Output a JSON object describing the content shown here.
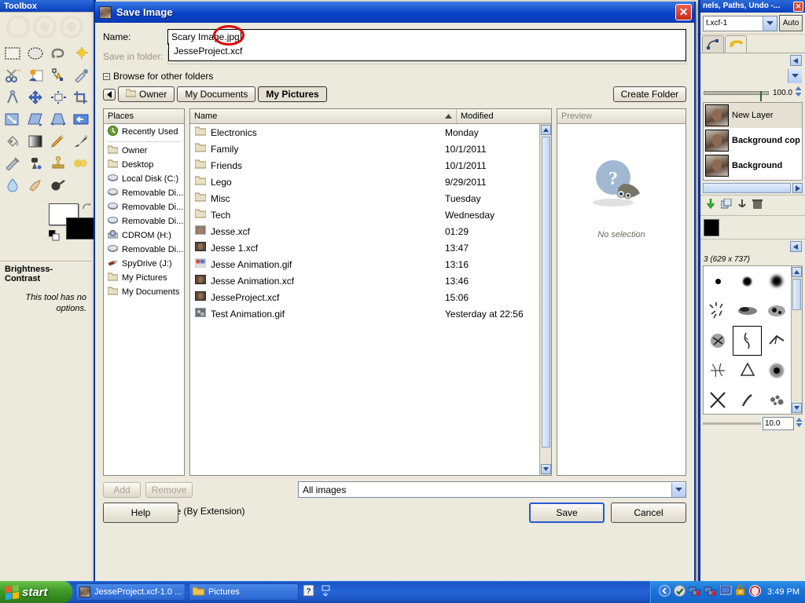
{
  "toolbox": {
    "title": "Toolbox",
    "tools": [
      "rect-select-tool",
      "ellipse-select-tool",
      "free-select-tool",
      "fuzzy-select-tool",
      "scissors-select-tool",
      "foreground-select-tool",
      "paths-tool",
      "color-picker-tool",
      "measure-tool",
      "move-tool",
      "alignment-tool",
      "crop-tool",
      "rotate-tool",
      "shear-tool",
      "perspective-tool",
      "flip-tool",
      "bucket-fill-tool",
      "gradient-tool",
      "pencil-tool",
      "paintbrush-tool",
      "airbrush-tool",
      "ink-tool",
      "clone-tool",
      "blur-sharpen-tool",
      "smudge-tool",
      "dodge-burn-tool",
      "eraser-tool"
    ],
    "active_tool_name": "Brightness-Contrast",
    "tool_note": "This tool has no options.",
    "foreground_color": "#ffffff",
    "background_color": "#000000"
  },
  "dock": {
    "title": "nels, Paths, Undo -...",
    "image_combo_value": "t.xcf-1",
    "auto_label": "Auto",
    "opacity_value": "100.0",
    "layers": [
      {
        "name": "New Layer",
        "selected": true,
        "bold": false
      },
      {
        "name": "Background copy",
        "selected": false,
        "bold": true
      },
      {
        "name": "Background",
        "selected": false,
        "bold": true
      }
    ],
    "brush_header": "3 (629 x 737)",
    "brush_size": "10.0"
  },
  "dialog": {
    "title": "Save Image",
    "name_label": "Name:",
    "name_value": "Scary Image.jpg",
    "autocomplete_suggestion": "JesseProject.xcf",
    "folder_label": "Save in folder:",
    "folder_value": "My Pictures",
    "browse_label": "Browse for other folders",
    "breadcrumb": [
      {
        "label": "Owner",
        "icon": "folder-icon",
        "active": false
      },
      {
        "label": "My Documents",
        "icon": "",
        "active": false
      },
      {
        "label": "My Pictures",
        "icon": "",
        "active": true
      }
    ],
    "create_folder_label": "Create Folder",
    "places_header": "Places",
    "places": [
      {
        "label": "Recently Used",
        "icon": "recent-icon"
      },
      {
        "label": "Owner",
        "icon": "folder-icon"
      },
      {
        "label": "Desktop",
        "icon": "folder-icon"
      },
      {
        "label": "Local Disk (C:)",
        "icon": "drive-icon"
      },
      {
        "label": "Removable Di...",
        "icon": "drive-icon"
      },
      {
        "label": "Removable Di...",
        "icon": "drive-icon"
      },
      {
        "label": "Removable Di...",
        "icon": "drive-icon"
      },
      {
        "label": "CDROM (H:)",
        "icon": "cdrom-icon"
      },
      {
        "label": "Removable Di...",
        "icon": "drive-icon"
      },
      {
        "label": "SpyDrive (J:)",
        "icon": "usb-icon"
      },
      {
        "label": "My Pictures",
        "icon": "folder-icon"
      },
      {
        "label": "My Documents",
        "icon": "folder-icon"
      }
    ],
    "columns": {
      "name": "Name",
      "modified": "Modified",
      "sort": "ascending"
    },
    "files": [
      {
        "name": "Electronics",
        "modified": "Monday",
        "type": "folder"
      },
      {
        "name": "Family",
        "modified": "10/1/2011",
        "type": "folder"
      },
      {
        "name": "Friends",
        "modified": "10/1/2011",
        "type": "folder"
      },
      {
        "name": "Lego",
        "modified": "9/29/2011",
        "type": "folder"
      },
      {
        "name": "Misc",
        "modified": "Tuesday",
        "type": "folder"
      },
      {
        "name": "Tech",
        "modified": "Wednesday",
        "type": "folder"
      },
      {
        "name": "Jesse.xcf",
        "modified": "01:29",
        "type": "photo"
      },
      {
        "name": "Jesse 1.xcf",
        "modified": "13:47",
        "type": "photo"
      },
      {
        "name": "Jesse Animation.gif",
        "modified": "13:16",
        "type": "gif"
      },
      {
        "name": "Jesse Animation.xcf",
        "modified": "13:46",
        "type": "photo"
      },
      {
        "name": "JesseProject.xcf",
        "modified": "15:06",
        "type": "photo"
      },
      {
        "name": "Test Animation.gif",
        "modified": "Yesterday at 22:56",
        "type": "gifgray"
      }
    ],
    "preview_header": "Preview",
    "preview_text": "No selection",
    "add_label": "Add",
    "remove_label": "Remove",
    "filetype_combo_value": "All images",
    "select_filetype_label": "Select File Type (By Extension)",
    "help_label": "Help",
    "save_label": "Save",
    "cancel_label": "Cancel",
    "annotation_color": "#e00000"
  },
  "taskbar": {
    "start_label": "start",
    "tasks": [
      {
        "label": "JesseProject.xcf-1.0 ...",
        "icon": "photo-icon"
      },
      {
        "label": "Pictures",
        "icon": "folder-icon"
      }
    ],
    "clock": "3:49 PM"
  }
}
